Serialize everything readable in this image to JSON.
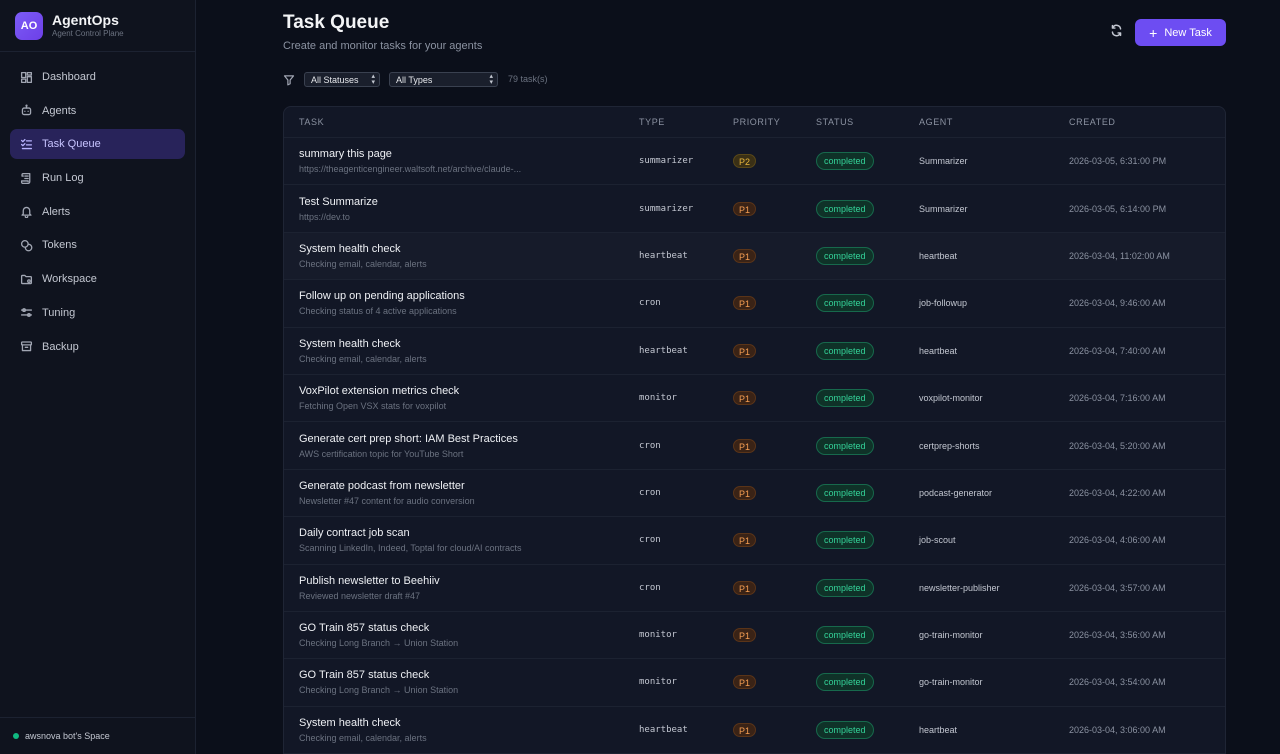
{
  "brand": {
    "logo": "AO",
    "name": "AgentOps",
    "subtitle": "Agent Control Plane"
  },
  "nav": [
    {
      "label": "Dashboard",
      "icon": "dashboard-icon",
      "active": false
    },
    {
      "label": "Agents",
      "icon": "bot-icon",
      "active": false
    },
    {
      "label": "Task Queue",
      "icon": "list-checks-icon",
      "active": true
    },
    {
      "label": "Run Log",
      "icon": "scroll-icon",
      "active": false
    },
    {
      "label": "Alerts",
      "icon": "bell-icon",
      "active": false
    },
    {
      "label": "Tokens",
      "icon": "coins-icon",
      "active": false
    },
    {
      "label": "Workspace",
      "icon": "folder-icon",
      "active": false
    },
    {
      "label": "Tuning",
      "icon": "sliders-icon",
      "active": false
    },
    {
      "label": "Backup",
      "icon": "archive-icon",
      "active": false
    }
  ],
  "space": {
    "label": "awsnova bot's Space",
    "status_color": "#10b981"
  },
  "header": {
    "title": "Task Queue",
    "subtitle": "Create and monitor tasks for your agents",
    "new_task_label": "New Task",
    "new_task_icon": "plus-icon",
    "refresh_icon": "refresh-icon"
  },
  "filters": {
    "status_value": "All Statuses",
    "type_value": "All Types",
    "count": "79 task(s)"
  },
  "colors": {
    "accent": "#6d4df2",
    "success": "#34d399",
    "priority_p1": "#f59e52",
    "priority_p2": "#e8b63c"
  },
  "table": {
    "headers": {
      "task": "TASK",
      "type": "TYPE",
      "priority": "PRIORITY",
      "status": "STATUS",
      "agent": "AGENT",
      "created": "CREATED"
    },
    "rows": [
      {
        "title": "summary this page",
        "sub": "https://theagenticengineer.waltsoft.net/archive/claude-...",
        "type": "summarizer",
        "priority": "P2",
        "status": "completed",
        "agent": "Summarizer",
        "created": "2026-03-05, 6:31:00 PM"
      },
      {
        "title": "Test Summarize",
        "sub": "https://dev.to",
        "type": "summarizer",
        "priority": "P1",
        "status": "completed",
        "agent": "Summarizer",
        "created": "2026-03-05, 6:14:00 PM"
      },
      {
        "title": "System health check",
        "sub": "Checking email, calendar, alerts",
        "type": "heartbeat",
        "priority": "P1",
        "status": "completed",
        "agent": "heartbeat",
        "created": "2026-03-04, 11:02:00 AM"
      },
      {
        "title": "Follow up on pending applications",
        "sub": "Checking status of 4 active applications",
        "type": "cron",
        "priority": "P1",
        "status": "completed",
        "agent": "job-followup",
        "created": "2026-03-04, 9:46:00 AM"
      },
      {
        "title": "System health check",
        "sub": "Checking email, calendar, alerts",
        "type": "heartbeat",
        "priority": "P1",
        "status": "completed",
        "agent": "heartbeat",
        "created": "2026-03-04, 7:40:00 AM"
      },
      {
        "title": "VoxPilot extension metrics check",
        "sub": "Fetching Open VSX stats for voxpilot",
        "type": "monitor",
        "priority": "P1",
        "status": "completed",
        "agent": "voxpilot-monitor",
        "created": "2026-03-04, 7:16:00 AM"
      },
      {
        "title": "Generate cert prep short: IAM Best Practices",
        "sub": "AWS certification topic for YouTube Short",
        "type": "cron",
        "priority": "P1",
        "status": "completed",
        "agent": "certprep-shorts",
        "created": "2026-03-04, 5:20:00 AM"
      },
      {
        "title": "Generate podcast from newsletter",
        "sub": "Newsletter #47 content for audio conversion",
        "type": "cron",
        "priority": "P1",
        "status": "completed",
        "agent": "podcast-generator",
        "created": "2026-03-04, 4:22:00 AM"
      },
      {
        "title": "Daily contract job scan",
        "sub": "Scanning LinkedIn, Indeed, Toptal for cloud/AI contracts",
        "type": "cron",
        "priority": "P1",
        "status": "completed",
        "agent": "job-scout",
        "created": "2026-03-04, 4:06:00 AM"
      },
      {
        "title": "Publish newsletter to Beehiiv",
        "sub": "Reviewed newsletter draft #47",
        "type": "cron",
        "priority": "P1",
        "status": "completed",
        "agent": "newsletter-publisher",
        "created": "2026-03-04, 3:57:00 AM"
      },
      {
        "title": "GO Train 857 status check",
        "sub": "Checking Long Branch → Union Station",
        "type": "monitor",
        "priority": "P1",
        "status": "completed",
        "agent": "go-train-monitor",
        "created": "2026-03-04, 3:56:00 AM"
      },
      {
        "title": "GO Train 857 status check",
        "sub": "Checking Long Branch → Union Station",
        "type": "monitor",
        "priority": "P1",
        "status": "completed",
        "agent": "go-train-monitor",
        "created": "2026-03-04, 3:54:00 AM"
      },
      {
        "title": "System health check",
        "sub": "Checking email, calendar, alerts",
        "type": "heartbeat",
        "priority": "P1",
        "status": "completed",
        "agent": "heartbeat",
        "created": "2026-03-04, 3:06:00 AM"
      }
    ]
  }
}
